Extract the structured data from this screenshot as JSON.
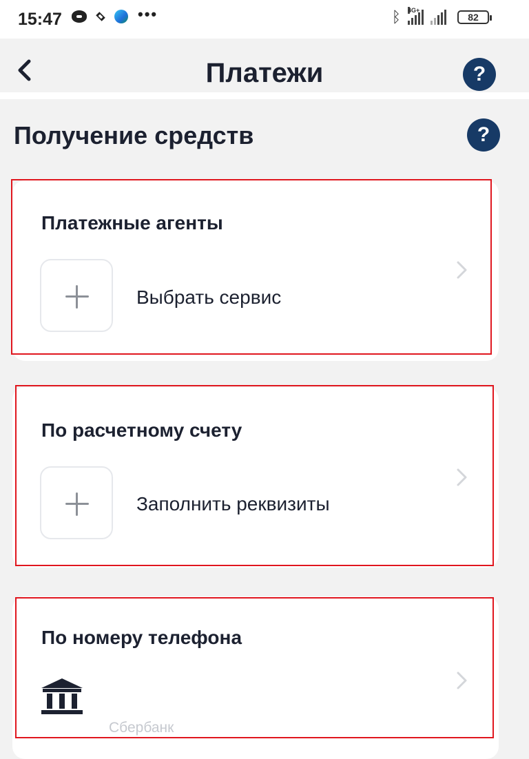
{
  "status_bar": {
    "time": "15:47",
    "network_label": "4G+",
    "battery": "82",
    "icons": [
      "oval-app-icon",
      "diamond-app-icon",
      "edge-browser-icon",
      "more-dots-icon",
      "bluetooth-icon",
      "signal-icon",
      "battery-icon"
    ]
  },
  "header": {
    "title": "Платежи",
    "back_icon": "chevron-left-icon",
    "help_label": "?"
  },
  "section": {
    "title": "Получение средств",
    "help_label": "?"
  },
  "cards": [
    {
      "title": "Платежные агенты",
      "action_label": "Выбрать сервис",
      "action_icon": "plus-icon"
    },
    {
      "title": "По расчетному счету",
      "action_label": "Заполнить реквизиты",
      "action_icon": "plus-icon"
    },
    {
      "title": "По номеру телефона",
      "bank_name": "Сбербанк",
      "bank_icon": "bank-icon"
    }
  ],
  "colors": {
    "background": "#f2f2f2",
    "card": "#ffffff",
    "help_button": "#173a66",
    "highlight_outline": "#e0161e",
    "text": "#1c2130",
    "muted_text": "#c6c9cf"
  }
}
